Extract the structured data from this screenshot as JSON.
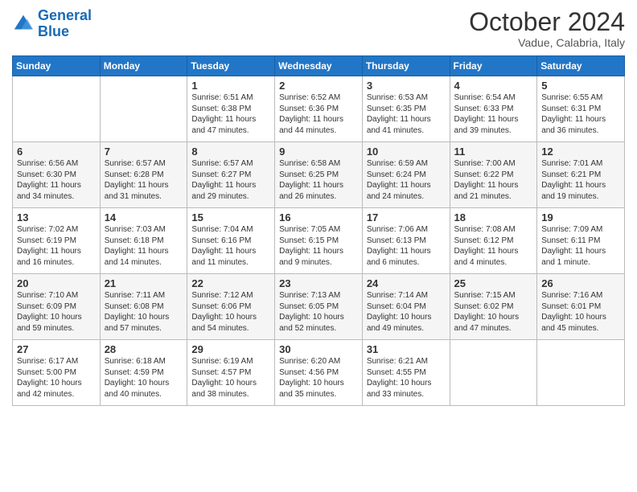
{
  "logo": {
    "line1": "General",
    "line2": "Blue"
  },
  "title": "October 2024",
  "subtitle": "Vadue, Calabria, Italy",
  "weekdays": [
    "Sunday",
    "Monday",
    "Tuesday",
    "Wednesday",
    "Thursday",
    "Friday",
    "Saturday"
  ],
  "weeks": [
    [
      {
        "day": "",
        "info": ""
      },
      {
        "day": "",
        "info": ""
      },
      {
        "day": "1",
        "info": "Sunrise: 6:51 AM\nSunset: 6:38 PM\nDaylight: 11 hours and 47 minutes."
      },
      {
        "day": "2",
        "info": "Sunrise: 6:52 AM\nSunset: 6:36 PM\nDaylight: 11 hours and 44 minutes."
      },
      {
        "day": "3",
        "info": "Sunrise: 6:53 AM\nSunset: 6:35 PM\nDaylight: 11 hours and 41 minutes."
      },
      {
        "day": "4",
        "info": "Sunrise: 6:54 AM\nSunset: 6:33 PM\nDaylight: 11 hours and 39 minutes."
      },
      {
        "day": "5",
        "info": "Sunrise: 6:55 AM\nSunset: 6:31 PM\nDaylight: 11 hours and 36 minutes."
      }
    ],
    [
      {
        "day": "6",
        "info": "Sunrise: 6:56 AM\nSunset: 6:30 PM\nDaylight: 11 hours and 34 minutes."
      },
      {
        "day": "7",
        "info": "Sunrise: 6:57 AM\nSunset: 6:28 PM\nDaylight: 11 hours and 31 minutes."
      },
      {
        "day": "8",
        "info": "Sunrise: 6:57 AM\nSunset: 6:27 PM\nDaylight: 11 hours and 29 minutes."
      },
      {
        "day": "9",
        "info": "Sunrise: 6:58 AM\nSunset: 6:25 PM\nDaylight: 11 hours and 26 minutes."
      },
      {
        "day": "10",
        "info": "Sunrise: 6:59 AM\nSunset: 6:24 PM\nDaylight: 11 hours and 24 minutes."
      },
      {
        "day": "11",
        "info": "Sunrise: 7:00 AM\nSunset: 6:22 PM\nDaylight: 11 hours and 21 minutes."
      },
      {
        "day": "12",
        "info": "Sunrise: 7:01 AM\nSunset: 6:21 PM\nDaylight: 11 hours and 19 minutes."
      }
    ],
    [
      {
        "day": "13",
        "info": "Sunrise: 7:02 AM\nSunset: 6:19 PM\nDaylight: 11 hours and 16 minutes."
      },
      {
        "day": "14",
        "info": "Sunrise: 7:03 AM\nSunset: 6:18 PM\nDaylight: 11 hours and 14 minutes."
      },
      {
        "day": "15",
        "info": "Sunrise: 7:04 AM\nSunset: 6:16 PM\nDaylight: 11 hours and 11 minutes."
      },
      {
        "day": "16",
        "info": "Sunrise: 7:05 AM\nSunset: 6:15 PM\nDaylight: 11 hours and 9 minutes."
      },
      {
        "day": "17",
        "info": "Sunrise: 7:06 AM\nSunset: 6:13 PM\nDaylight: 11 hours and 6 minutes."
      },
      {
        "day": "18",
        "info": "Sunrise: 7:08 AM\nSunset: 6:12 PM\nDaylight: 11 hours and 4 minutes."
      },
      {
        "day": "19",
        "info": "Sunrise: 7:09 AM\nSunset: 6:11 PM\nDaylight: 11 hours and 1 minute."
      }
    ],
    [
      {
        "day": "20",
        "info": "Sunrise: 7:10 AM\nSunset: 6:09 PM\nDaylight: 10 hours and 59 minutes."
      },
      {
        "day": "21",
        "info": "Sunrise: 7:11 AM\nSunset: 6:08 PM\nDaylight: 10 hours and 57 minutes."
      },
      {
        "day": "22",
        "info": "Sunrise: 7:12 AM\nSunset: 6:06 PM\nDaylight: 10 hours and 54 minutes."
      },
      {
        "day": "23",
        "info": "Sunrise: 7:13 AM\nSunset: 6:05 PM\nDaylight: 10 hours and 52 minutes."
      },
      {
        "day": "24",
        "info": "Sunrise: 7:14 AM\nSunset: 6:04 PM\nDaylight: 10 hours and 49 minutes."
      },
      {
        "day": "25",
        "info": "Sunrise: 7:15 AM\nSunset: 6:02 PM\nDaylight: 10 hours and 47 minutes."
      },
      {
        "day": "26",
        "info": "Sunrise: 7:16 AM\nSunset: 6:01 PM\nDaylight: 10 hours and 45 minutes."
      }
    ],
    [
      {
        "day": "27",
        "info": "Sunrise: 6:17 AM\nSunset: 5:00 PM\nDaylight: 10 hours and 42 minutes."
      },
      {
        "day": "28",
        "info": "Sunrise: 6:18 AM\nSunset: 4:59 PM\nDaylight: 10 hours and 40 minutes."
      },
      {
        "day": "29",
        "info": "Sunrise: 6:19 AM\nSunset: 4:57 PM\nDaylight: 10 hours and 38 minutes."
      },
      {
        "day": "30",
        "info": "Sunrise: 6:20 AM\nSunset: 4:56 PM\nDaylight: 10 hours and 35 minutes."
      },
      {
        "day": "31",
        "info": "Sunrise: 6:21 AM\nSunset: 4:55 PM\nDaylight: 10 hours and 33 minutes."
      },
      {
        "day": "",
        "info": ""
      },
      {
        "day": "",
        "info": ""
      }
    ]
  ]
}
